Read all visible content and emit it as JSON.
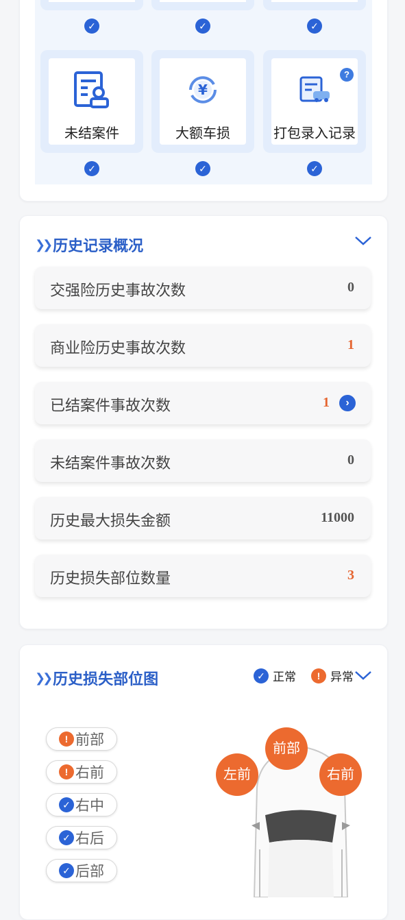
{
  "colors": {
    "accent": "#2b63d6",
    "warning": "#e5642f",
    "title": "#2b5fc7"
  },
  "tiles": [
    {
      "label": "未结案件",
      "icon": "case-document-icon"
    },
    {
      "label": "大额车损",
      "icon": "yuan-refresh-icon"
    },
    {
      "label": "打包录入记录",
      "icon": "car-form-icon",
      "help": "?"
    }
  ],
  "history": {
    "title": "历史记录概况",
    "rows": [
      {
        "label": "交强险历史事故次数",
        "value": "0"
      },
      {
        "label": "商业险历史事故次数",
        "value": "1"
      },
      {
        "label": "已结案件事故次数",
        "value": "1"
      },
      {
        "label": "未结案件事故次数",
        "value": "0"
      },
      {
        "label": "历史最大损失金额",
        "value": "11000"
      },
      {
        "label": "历史损失部位数量",
        "value": "3"
      }
    ]
  },
  "damage_map": {
    "title": "历史损失部位图",
    "legend_normal": "正常",
    "legend_abnormal": "异常",
    "parts": [
      {
        "label": "前部",
        "status": "abnormal"
      },
      {
        "label": "右前",
        "status": "abnormal"
      },
      {
        "label": "右中",
        "status": "normal"
      },
      {
        "label": "右后",
        "status": "normal"
      },
      {
        "label": "后部",
        "status": "normal"
      }
    ],
    "bubbles": {
      "left_front": "左前",
      "front": "前部",
      "right_front": "右前"
    }
  }
}
